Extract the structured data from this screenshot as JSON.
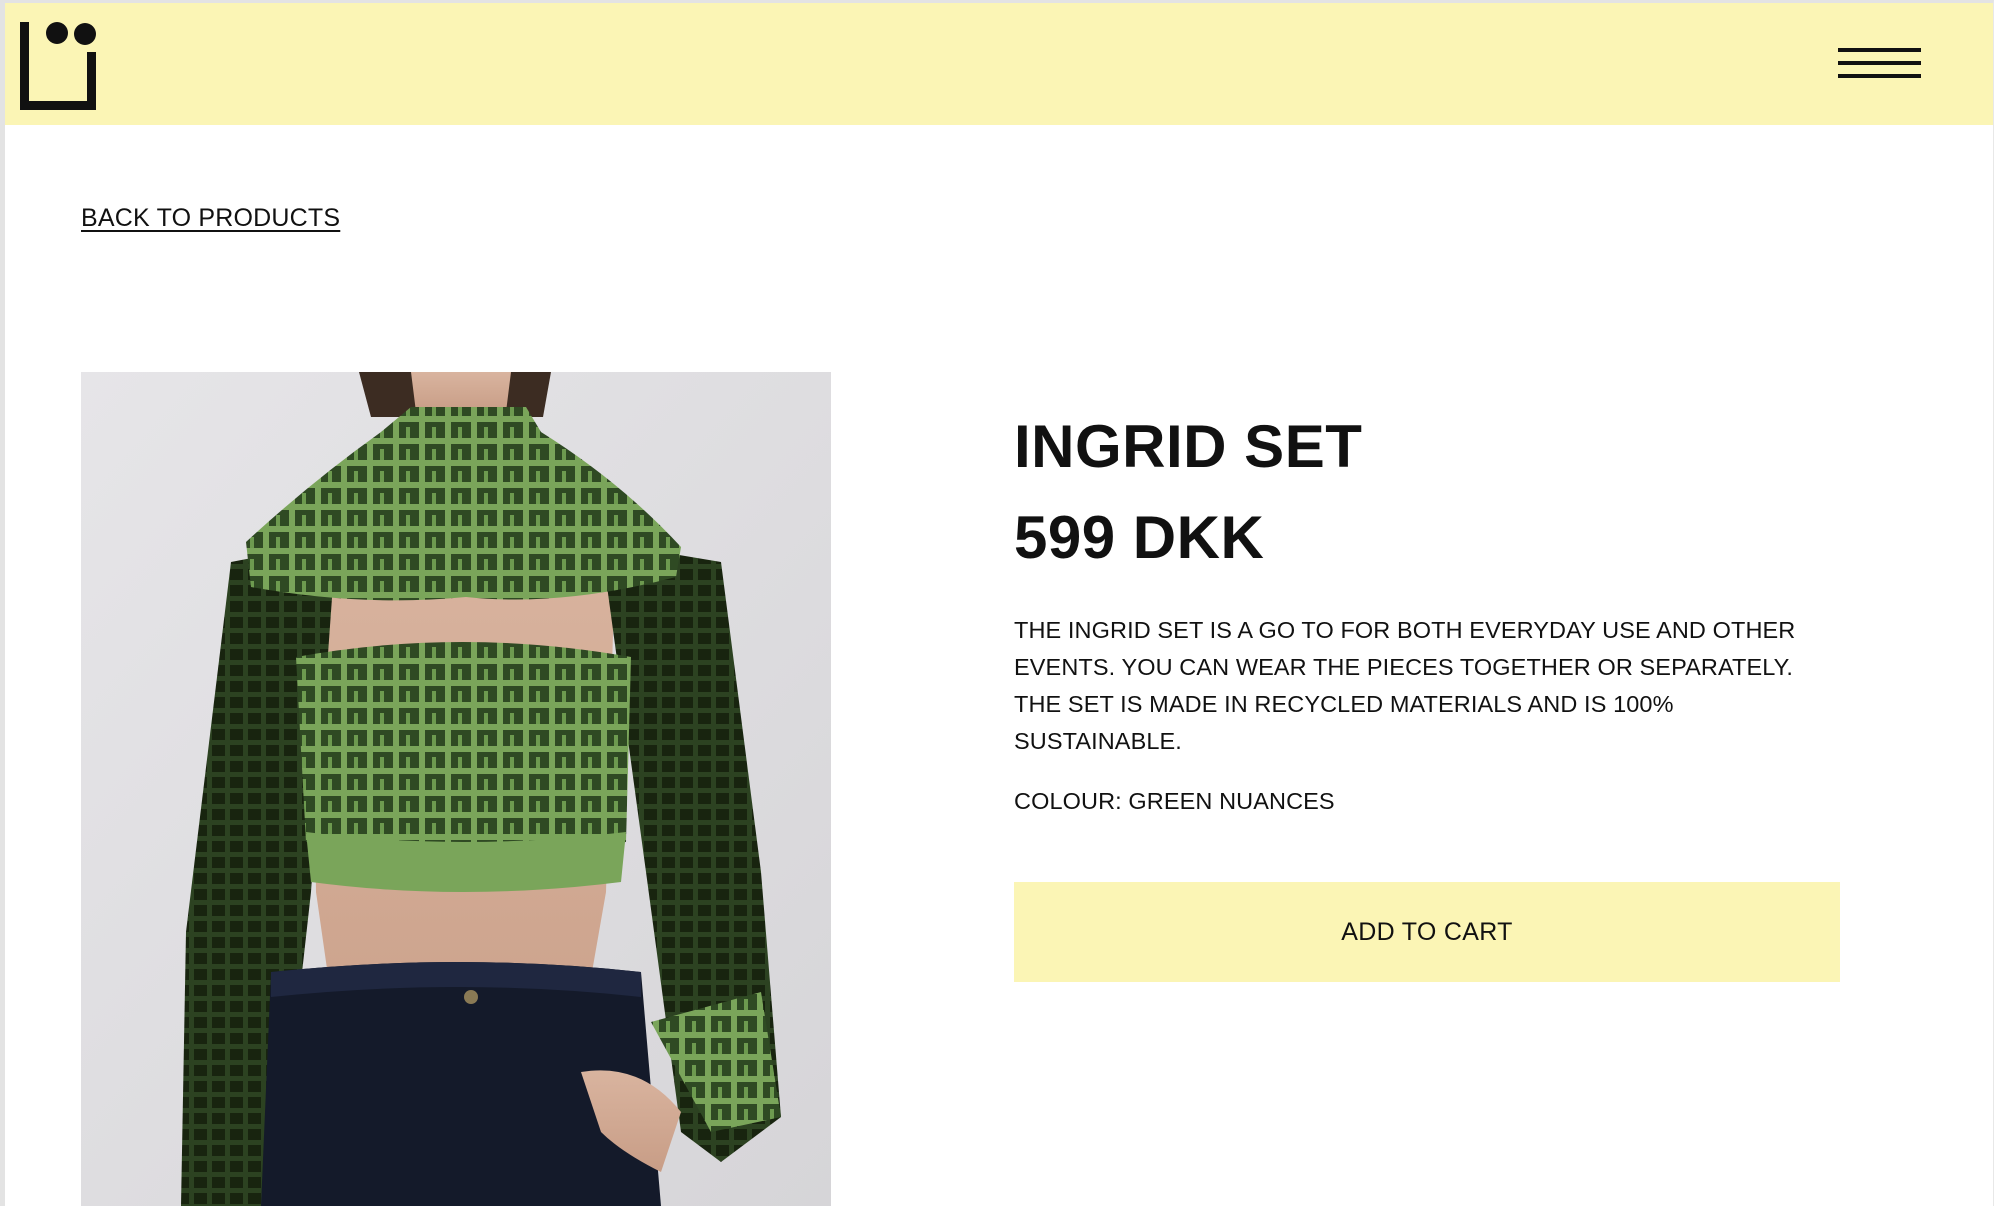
{
  "header": {
    "logo_icon": "brand-logo-icon",
    "menu_icon": "hamburger-menu-icon"
  },
  "nav": {
    "back_label": "BACK TO PRODUCTS"
  },
  "product": {
    "title": "INGRID SET",
    "price": "599 DKK",
    "description": "THE INGRID SET IS A GO TO FOR BOTH EVERYDAY USE AND OTHER EVENTS. YOU CAN WEAR THE PIECES TOGETHER OR SEPARATELY. THE SET IS MADE IN RECYCLED MATERIALS AND IS 100% SUSTAINABLE.",
    "colour": "COLOUR: GREEN NUANCES",
    "add_to_cart_label": "ADD TO CART",
    "image_subject": "model-wearing-green-crochet-set"
  },
  "colors": {
    "header_bg": "#fbf5b5",
    "button_bg": "#fbf5b5",
    "text": "#111111",
    "knit_light": "#7aa55a",
    "knit_dark": "#26391d"
  }
}
